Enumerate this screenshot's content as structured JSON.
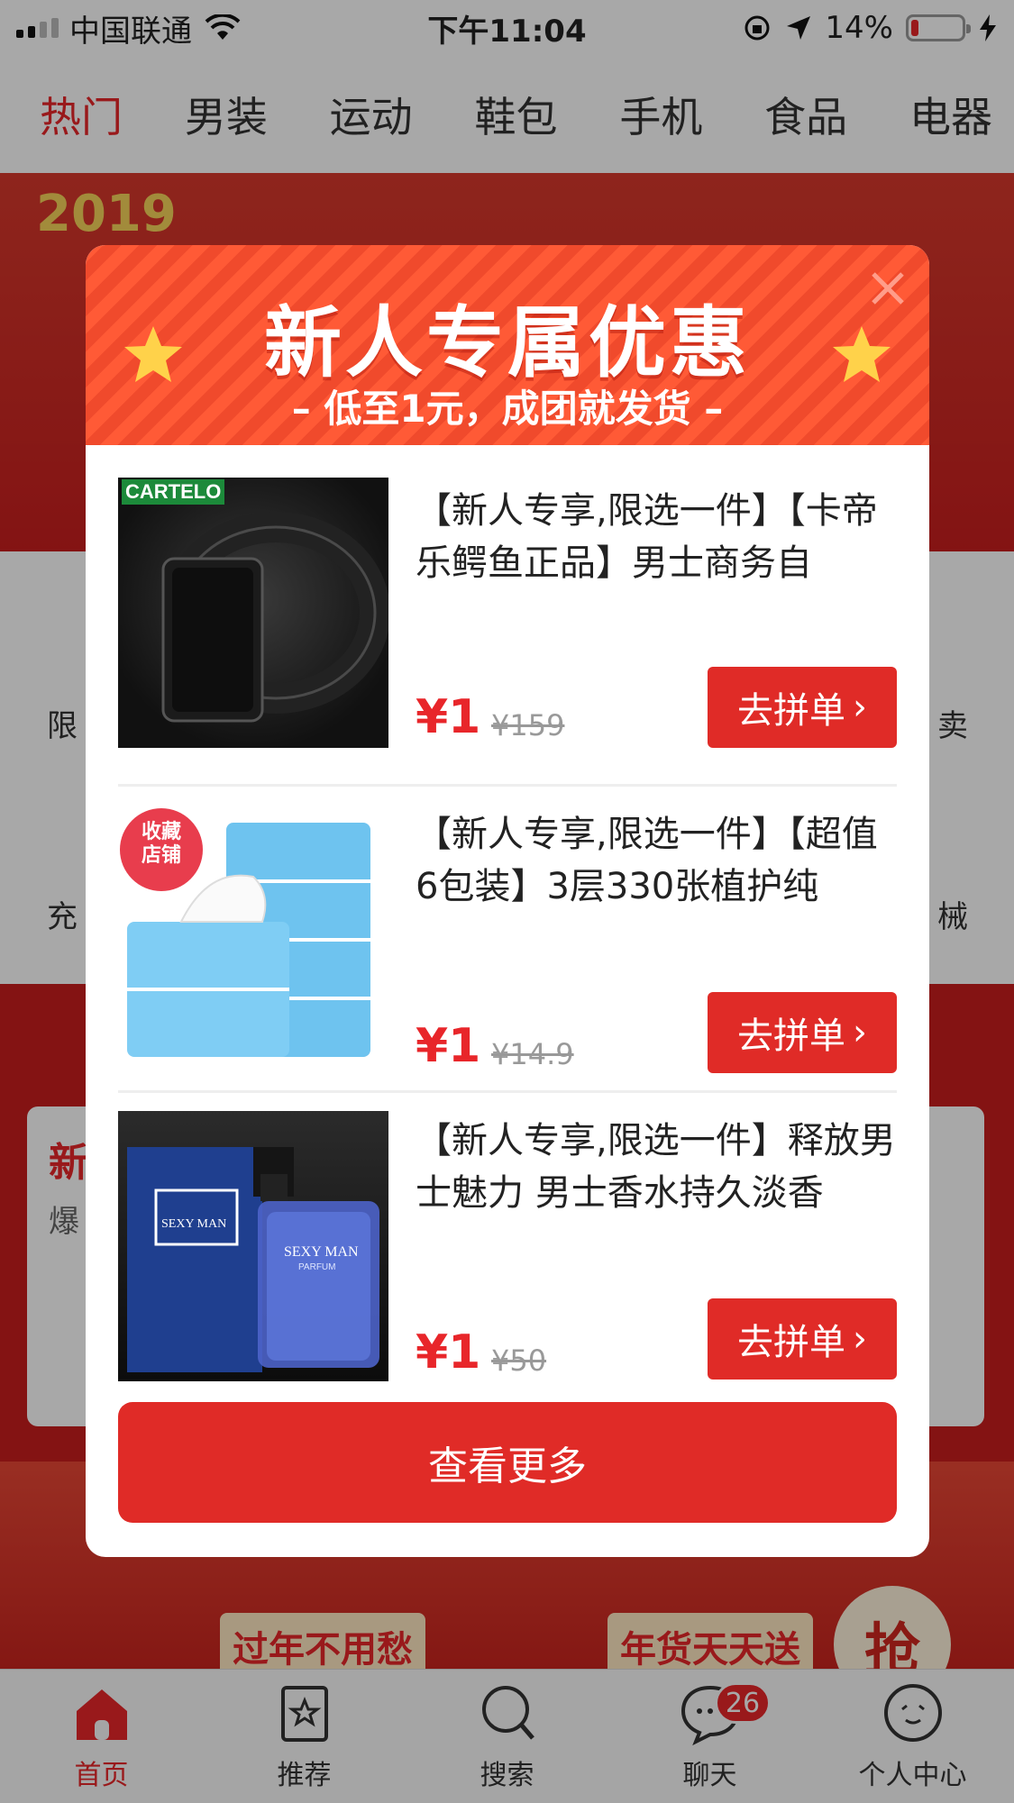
{
  "status_bar": {
    "carrier": "中国联通",
    "time": "下午11:04",
    "battery_text": "14%",
    "battery_level": 0.14
  },
  "categories": [
    {
      "label": "热门",
      "active": true
    },
    {
      "label": "男装"
    },
    {
      "label": "运动"
    },
    {
      "label": "鞋包"
    },
    {
      "label": "手机"
    },
    {
      "label": "食品"
    },
    {
      "label": "电器"
    }
  ],
  "background": {
    "banner_year": "2019",
    "grid_labels": {
      "row1_left": "限",
      "row1_right": "卖",
      "row2_left": "充",
      "row2_right": "械"
    },
    "panel_text": {
      "title": "新",
      "sub": "爆"
    },
    "promos": [
      "过年不用愁",
      "年货天天送"
    ],
    "grab_label": "抢"
  },
  "modal": {
    "title": "新人专属优惠",
    "subtitle": "– 低至1元，成团就发货 –",
    "products": [
      {
        "title": "【新人专享,限选一件】【卡帝乐鳄鱼正品】男士商务自",
        "price": "¥1",
        "original_price": "¥159",
        "button": "去拼单",
        "image_brand": "CARTELO"
      },
      {
        "title": "【新人专享,限选一件】【超值6包装】3层330张植护纯",
        "price": "¥1",
        "original_price": "¥14.9",
        "button": "去拼单",
        "image_badge": "收藏\n店铺"
      },
      {
        "title": "【新人专享,限选一件】释放男士魅力 男士香水持久淡香",
        "price": "¥1",
        "original_price": "¥50",
        "button": "去拼单",
        "image_brand": "SEXY MAN",
        "image_sub": "PARFUM"
      }
    ],
    "view_more": "查看更多"
  },
  "bottom_nav": [
    {
      "label": "首页",
      "icon": "home-icon",
      "active": true
    },
    {
      "label": "推荐",
      "icon": "star-icon"
    },
    {
      "label": "搜索",
      "icon": "search-icon"
    },
    {
      "label": "聊天",
      "icon": "chat-icon",
      "badge": "26"
    },
    {
      "label": "个人中心",
      "icon": "profile-icon"
    }
  ],
  "colors": {
    "accent": "#e8262a",
    "button": "#e02b27",
    "header": "#f04a2c"
  }
}
